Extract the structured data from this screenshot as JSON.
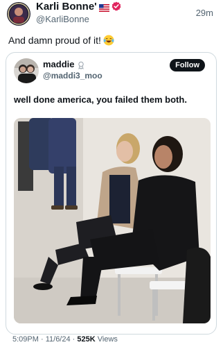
{
  "author": {
    "display_name": "Karli Bonne'",
    "handle": "@KarliBonne",
    "flag_icon": "us-flag-icon",
    "verified_icon": "verified-badge-icon"
  },
  "post": {
    "time_ago": "29m",
    "text": "And damn proud of it!",
    "emoji": "laughing-tears-emoji"
  },
  "quoted": {
    "display_name": "maddie",
    "handle": "@maddi3_moo",
    "follow_label": "Follow",
    "text": "well done america, you failed them both."
  },
  "meta": {
    "time": "5:09PM",
    "date": "11/6/24",
    "views": "525K",
    "views_label": "Views",
    "separator": "·"
  },
  "colors": {
    "text": "#0f1419",
    "secondary": "#536471",
    "verified": "#e0245e",
    "border": "#cfd9de"
  }
}
